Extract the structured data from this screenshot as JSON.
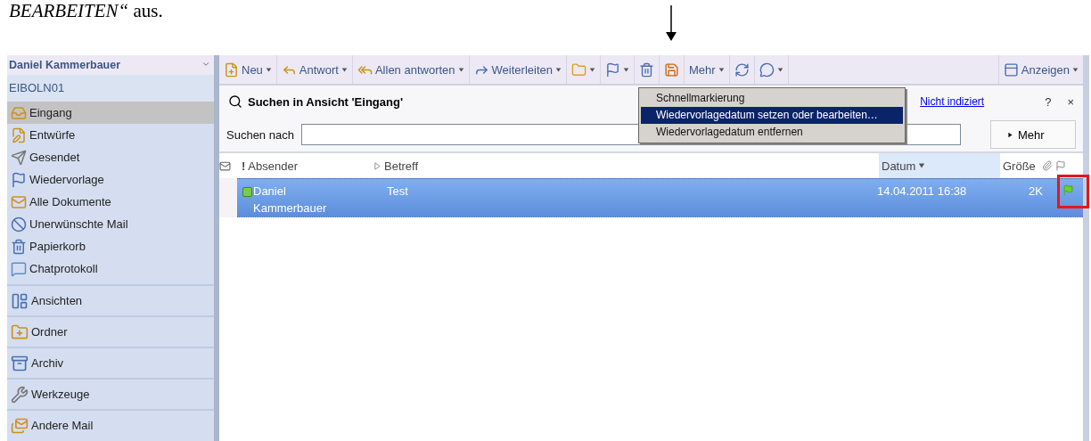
{
  "document": {
    "text": "*BEARBEITEN“* aus."
  },
  "sidebar": {
    "user": "Daniel Kammerbauer",
    "server": "EIBOLN01",
    "folders": [
      {
        "label": "Eingang",
        "selected": true
      },
      {
        "label": "Entwürfe",
        "selected": false
      },
      {
        "label": "Gesendet",
        "selected": false
      },
      {
        "label": "Wiedervorlage",
        "selected": false
      },
      {
        "label": "Alle Dokumente",
        "selected": false
      },
      {
        "label": "Unerwünschte Mail",
        "selected": false
      },
      {
        "label": "Papierkorb",
        "selected": false
      },
      {
        "label": "Chatprotokoll",
        "selected": false
      }
    ],
    "sections": [
      {
        "label": "Ansichten"
      },
      {
        "label": "Ordner"
      },
      {
        "label": "Archiv"
      },
      {
        "label": "Werkzeuge"
      },
      {
        "label": "Andere Mail"
      }
    ]
  },
  "toolbar": {
    "buttons": [
      {
        "label": "Neu",
        "menu": true
      },
      {
        "label": "Antwort",
        "menu": true
      },
      {
        "label": "Allen antworten",
        "menu": true
      },
      {
        "label": "Weiterleiten",
        "menu": true
      },
      {
        "menu": true
      },
      {
        "menu": true
      },
      {
        "menu": false
      },
      {
        "menu": false
      },
      {
        "label": "Mehr",
        "menu": true
      },
      {
        "menu": false
      },
      {
        "menu": true
      }
    ],
    "view_button": {
      "label": "Anzeigen",
      "menu": true
    }
  },
  "flag_menu": {
    "items": [
      {
        "label": "Schnellmarkierung",
        "selected": false
      },
      {
        "label": "Wiedervorlagedatum setzen oder bearbeiten…",
        "selected": true
      },
      {
        "label": "Wiedervorlagedatum entfernen",
        "selected": false
      }
    ]
  },
  "search": {
    "title": "Suchen in Ansicht 'Eingang'",
    "link": "Nicht indiziert",
    "help": "?",
    "close": "×",
    "label": "Suchen nach",
    "more": "Mehr"
  },
  "table": {
    "header_mark": "!",
    "columns": [
      {
        "label": "Absender",
        "sorted": false
      },
      {
        "label": "Betreff",
        "sorted": false
      },
      {
        "label": "Datum",
        "sorted": true
      },
      {
        "label": "Größe",
        "sorted": false
      }
    ],
    "rows": [
      {
        "sender": "Daniel Kammerbauer",
        "subject": "Test",
        "date": "14.04.2011 16:38",
        "size": "2K",
        "selected": true,
        "flagged": true
      }
    ]
  }
}
